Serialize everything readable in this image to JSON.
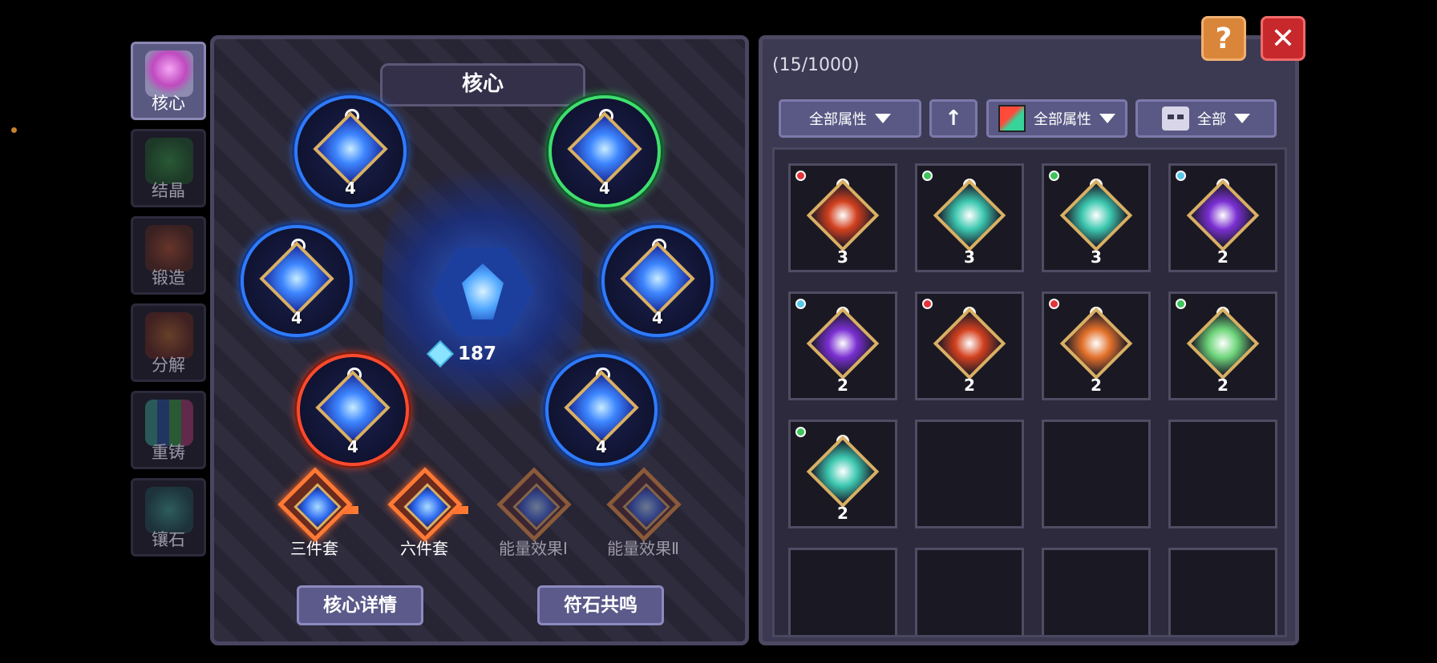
{
  "side_tabs": [
    {
      "label": "核心",
      "icon": "core-icon",
      "active": true,
      "color": "#f5a5f5"
    },
    {
      "label": "结晶",
      "icon": "crystal-icon",
      "active": false,
      "color": "#3cbf4a"
    },
    {
      "label": "锻造",
      "icon": "forge-icon",
      "active": false,
      "color": "#e0602e"
    },
    {
      "label": "分解",
      "icon": "dismantle-icon",
      "active": false,
      "color": "#e07a2a"
    },
    {
      "label": "重铸",
      "icon": "reforge-icon",
      "active": false,
      "color": "#3cc0a8"
    },
    {
      "label": "镶石",
      "icon": "inlay-icon",
      "active": false,
      "color": "#47c9b5"
    }
  ],
  "core_panel": {
    "title": "核心",
    "energy_value": "187",
    "sockets": [
      {
        "level": "4",
        "ring": "blue"
      },
      {
        "level": "4",
        "ring": "green"
      },
      {
        "level": "4",
        "ring": "blue"
      },
      {
        "level": "4",
        "ring": "blue"
      },
      {
        "level": "4",
        "ring": "red"
      },
      {
        "level": "4",
        "ring": "blue"
      }
    ],
    "set_effects": [
      {
        "label": "三件套",
        "active": true
      },
      {
        "label": "六件套",
        "active": true
      },
      {
        "label": "能量效果Ⅰ",
        "active": false
      },
      {
        "label": "能量效果Ⅱ",
        "active": false
      }
    ],
    "details_button": "核心详情",
    "resonance_button": "符石共鸣"
  },
  "inventory": {
    "count": "(15/1000)",
    "filters": {
      "attribute_label": "全部属性",
      "sort_icon": "arrow-up-icon",
      "color_attribute_label": "全部属性",
      "type_label": "全部"
    },
    "items": [
      {
        "element": "fire",
        "element_color": "#e3333a",
        "gem_color": "#d2401e",
        "count": "3"
      },
      {
        "element": "nature",
        "element_color": "#3ec45a",
        "gem_color": "#3dc8b0",
        "count": "3"
      },
      {
        "element": "nature",
        "element_color": "#3ec45a",
        "gem_color": "#3dc8b0",
        "count": "3"
      },
      {
        "element": "water",
        "element_color": "#57c8e8",
        "gem_color": "#7a2fd2",
        "count": "2"
      },
      {
        "element": "water",
        "element_color": "#57c8e8",
        "gem_color": "#7a2fd2",
        "count": "2"
      },
      {
        "element": "fire",
        "element_color": "#e3333a",
        "gem_color": "#d2401e",
        "count": "2"
      },
      {
        "element": "fire",
        "element_color": "#e3333a",
        "gem_color": "#e2702a",
        "count": "2"
      },
      {
        "element": "nature",
        "element_color": "#3ec45a",
        "gem_color": "#6ed57a",
        "count": "2"
      },
      {
        "element": "nature",
        "element_color": "#3ec45a",
        "gem_color": "#3dc8b0",
        "count": "2"
      }
    ]
  },
  "top_buttons": {
    "help": "?",
    "close": "✕"
  }
}
